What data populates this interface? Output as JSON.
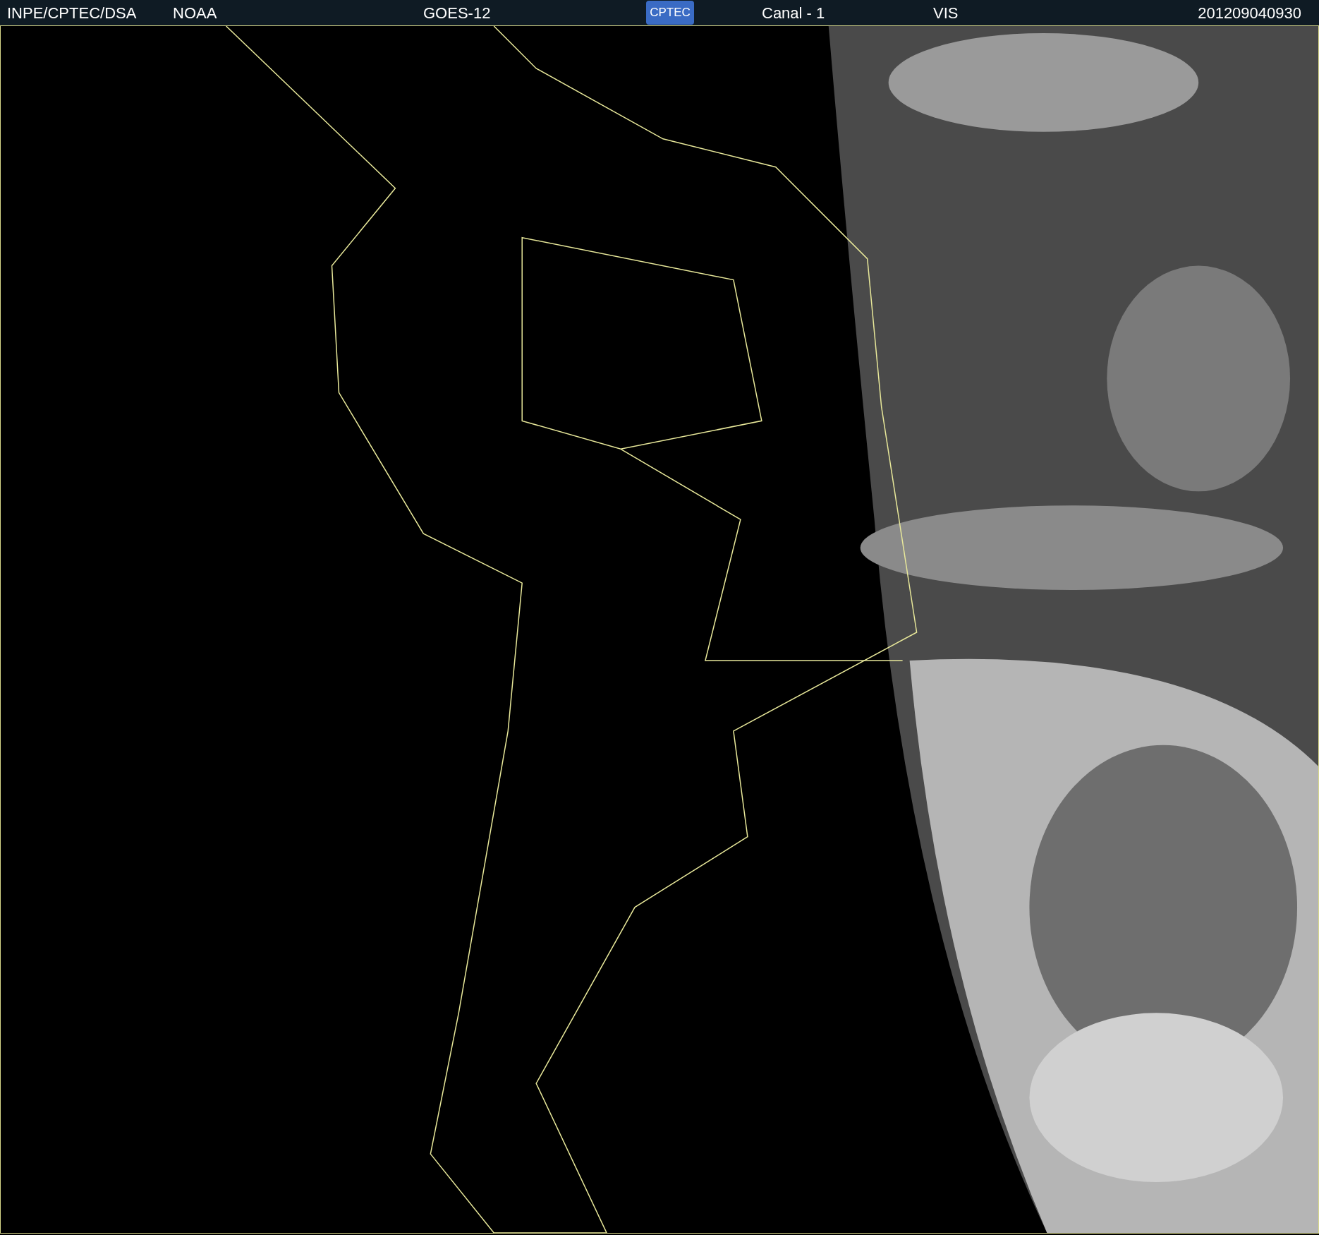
{
  "header": {
    "items": [
      "INPE/CPTEC/DSA",
      "NOAA",
      "GOES-12"
    ],
    "logo": "CPTEC",
    "channel": "Canal - 1",
    "band": "VIS",
    "timestamp": "201209040930"
  }
}
